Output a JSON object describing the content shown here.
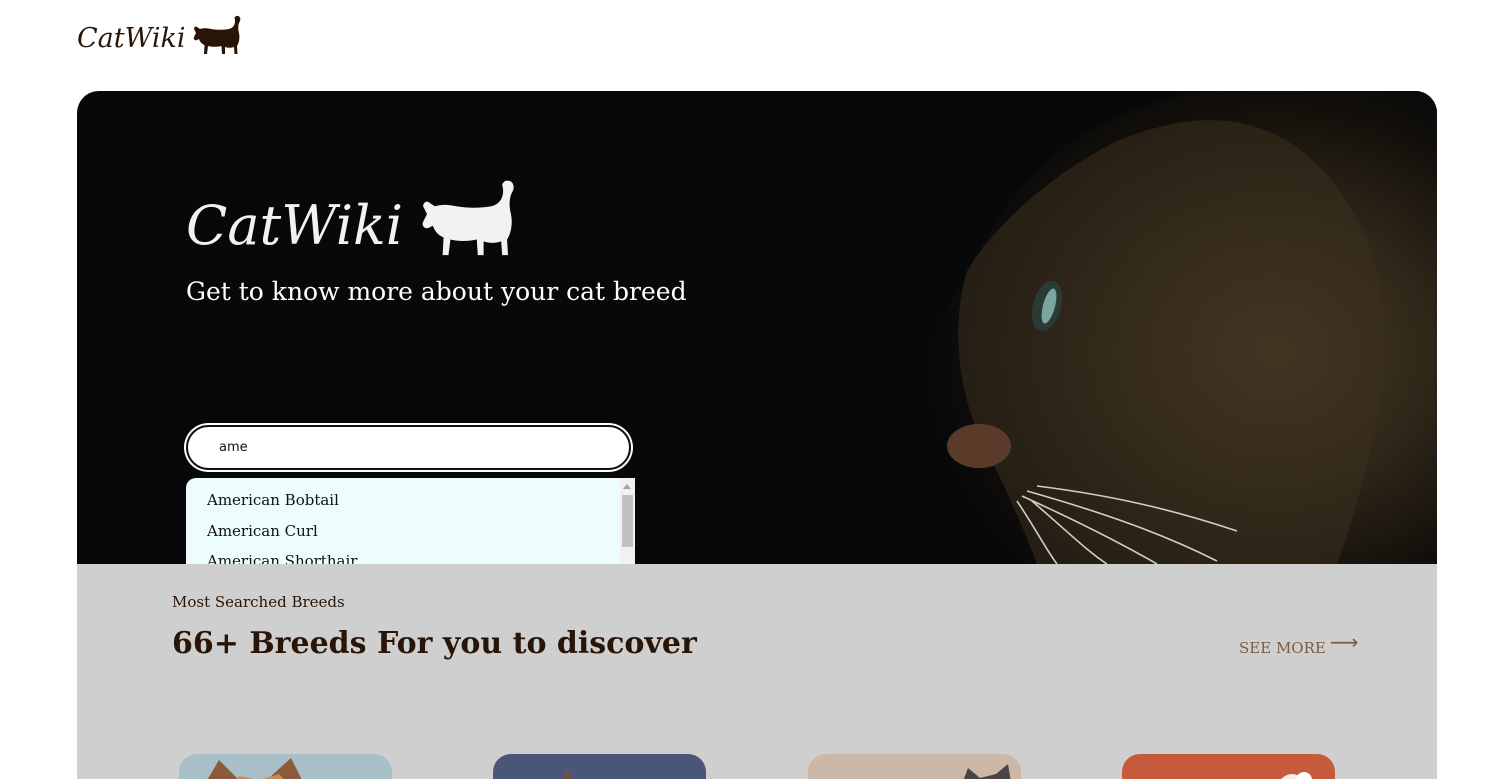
{
  "header": {
    "logo_text": "CatWiki",
    "logo_icon": "cat-silhouette-icon"
  },
  "hero": {
    "logo_text": "CatWiki",
    "logo_icon": "cat-silhouette-icon",
    "tagline": "Get to know more about your cat breed",
    "background_color": "#07080a"
  },
  "search": {
    "value": "ame",
    "suggestions": [
      "American Bobtail",
      "American Curl",
      "American Shorthair"
    ]
  },
  "breeds_section": {
    "eyebrow": "Most Searched Breeds",
    "title": "66+ Breeds For you to discover",
    "see_more_label": "SEE MORE",
    "see_more_icon": "arrow-right-icon",
    "background_color": "#cfcfcf"
  },
  "colors": {
    "brand_dark": "#291507",
    "dropdown_bg": "#edfdfd"
  }
}
